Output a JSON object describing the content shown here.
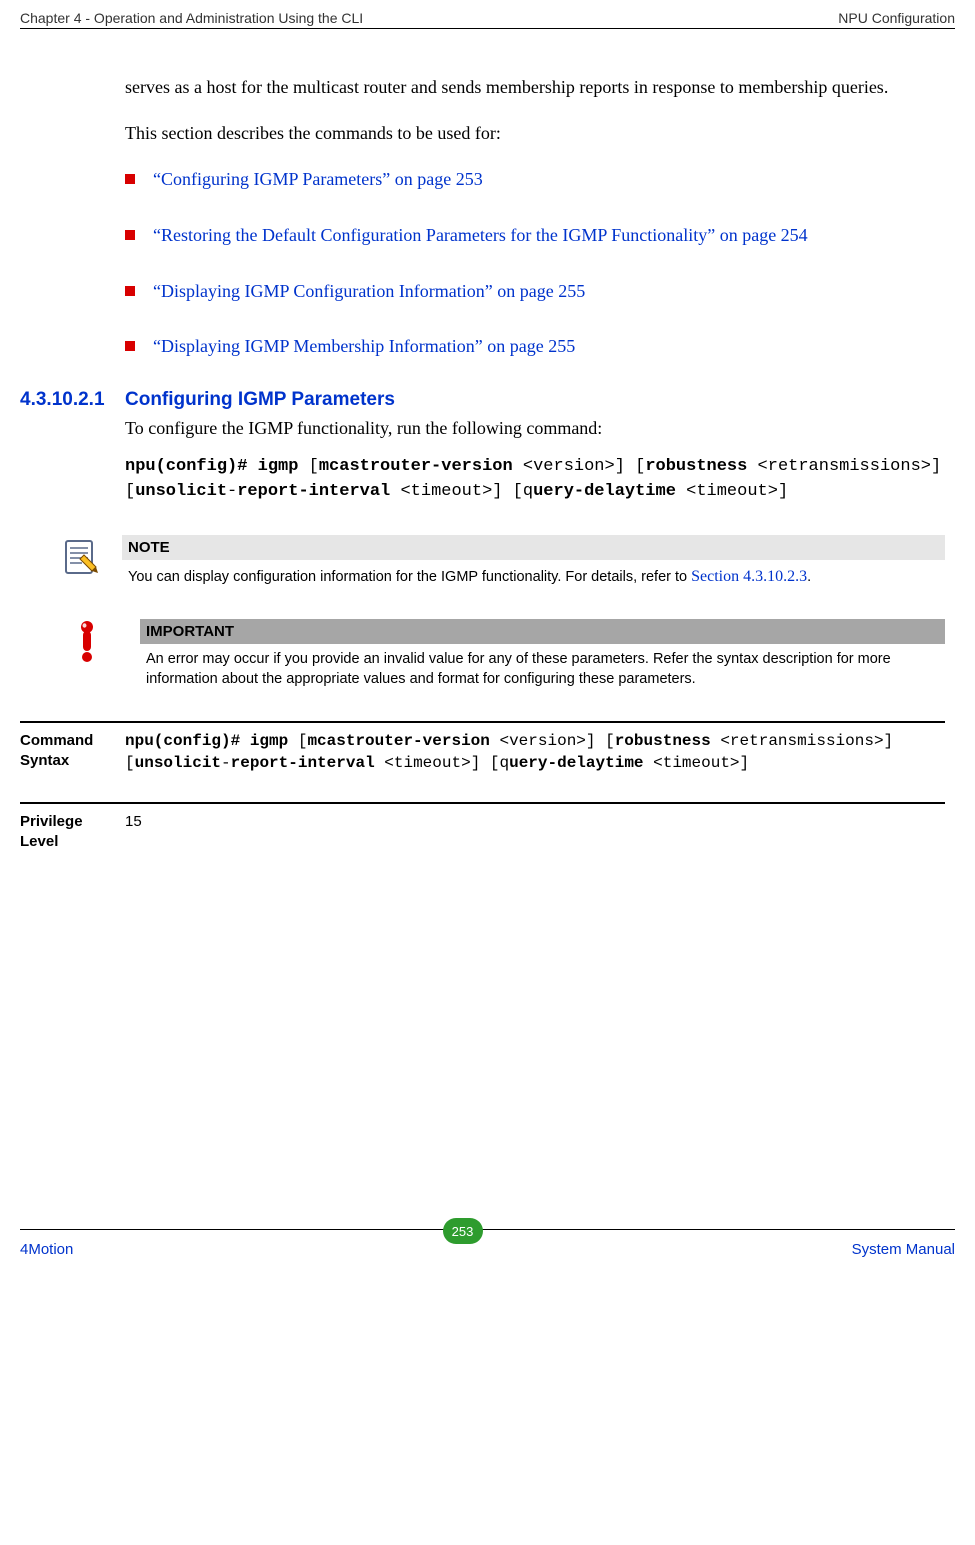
{
  "header": {
    "left": "Chapter 4 - Operation and Administration Using the CLI",
    "right": "NPU Configuration"
  },
  "intro": {
    "p1": "serves as a host for the multicast router and sends membership reports in response to membership queries.",
    "p2": "This section describes the commands to be used for:"
  },
  "bullets": {
    "b1": "“Configuring IGMP Parameters” on page 253",
    "b2": "“Restoring the Default Configuration Parameters for the IGMP Functionality” on page 254",
    "b3": "“Displaying IGMP Configuration Information” on page 255",
    "b4": "“Displaying IGMP Membership Information” on page 255"
  },
  "section": {
    "number": "4.3.10.2.1",
    "title": "Configuring IGMP Parameters",
    "lead": "To configure the IGMP functionality, run the following command:",
    "cmd": {
      "s1": "npu(config)# igmp",
      "s2": " [",
      "s3": "mcastrouter-version",
      "s4": " <version>] [",
      "s5": "robustness",
      "s6": " <retransmissions>] [",
      "s7": "unsolicit",
      "s8": "-",
      "s9": "report-interval",
      "s10": " <timeout>] [q",
      "s11": "uery-delaytime",
      "s12": " <timeout>]"
    }
  },
  "note": {
    "title": "NOTE",
    "text": "You can display configuration information for the IGMP functionality. For details, refer to ",
    "link": "Section 4.3.10.2.3",
    "period": "."
  },
  "important": {
    "title": "IMPORTANT",
    "text": "An error may occur if you provide an invalid value for any of these parameters. Refer the syntax description for more information about the appropriate values and format for configuring these parameters."
  },
  "syntax": {
    "label": "Command Syntax",
    "cmd": {
      "s1": "npu(config)# igmp",
      "s2": " [",
      "s3": "mcastrouter-version",
      "s4": " <version>] [",
      "s5": "robustness",
      "s6": " <retransmissions>] [",
      "s7": "unsolicit",
      "s8": "-",
      "s9": "report-interval",
      "s10": " <timeout>] [q",
      "s11": "uery-delaytime",
      "s12": " <timeout>]"
    }
  },
  "privilege": {
    "label": "Privilege Level",
    "value": "15"
  },
  "footer": {
    "left": "4Motion",
    "page": "253",
    "right": "System Manual"
  }
}
